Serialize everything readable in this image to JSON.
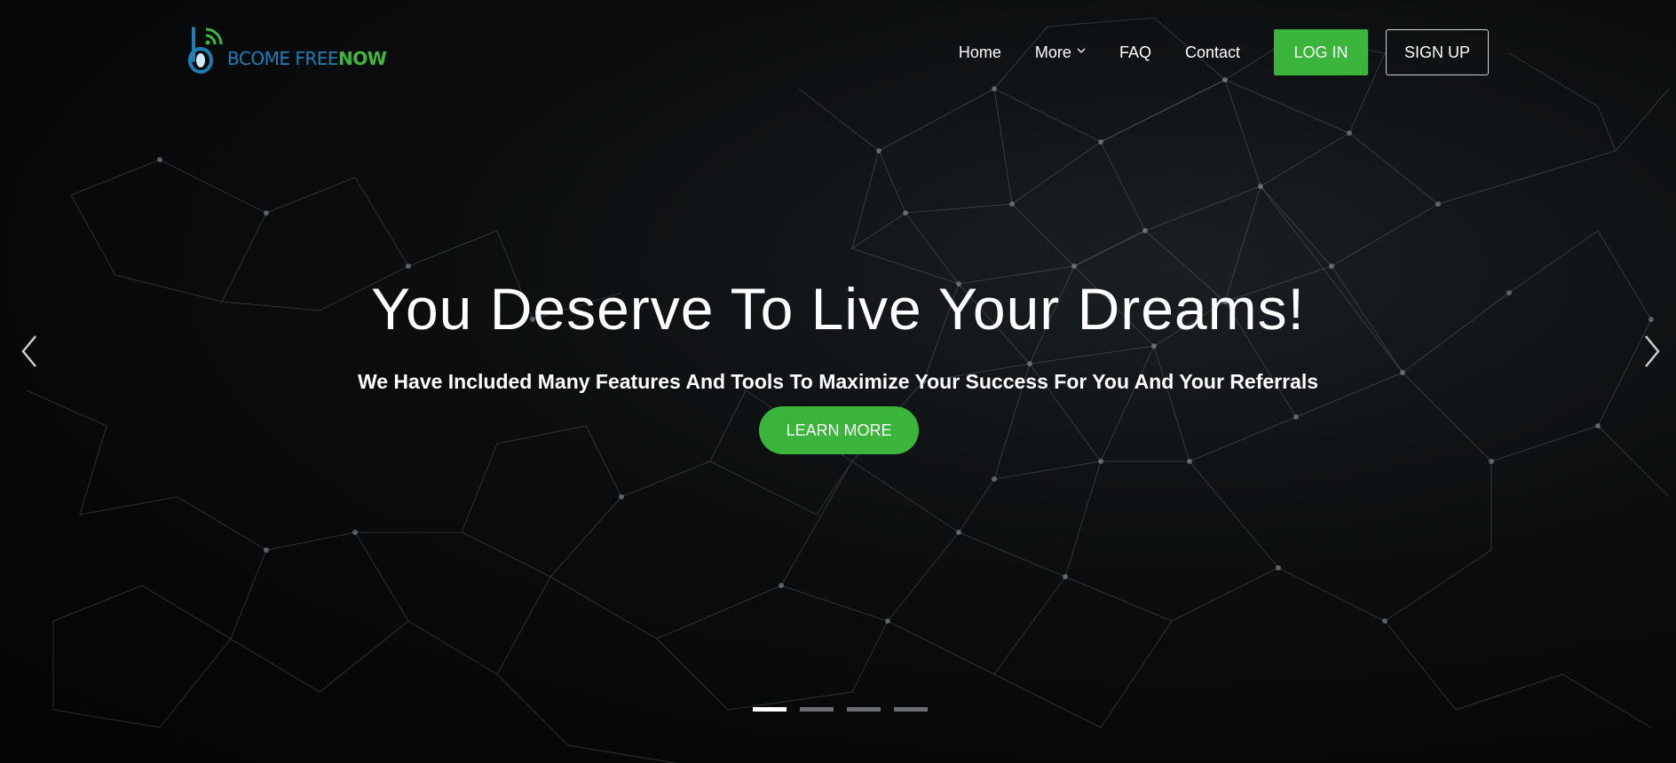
{
  "brand": {
    "name_part1": "BCOME FREE",
    "name_part2": "NOW",
    "logo_icon": "wifi-b-logo-icon",
    "color_blue": "#1d7fb8",
    "color_green": "#3cb93c"
  },
  "nav": {
    "items": [
      {
        "label": "Home"
      },
      {
        "label": "More",
        "icon": "chevron-down-icon"
      },
      {
        "label": "FAQ"
      },
      {
        "label": "Contact"
      }
    ],
    "login_label": "LOG IN",
    "signup_label": "SIGN UP"
  },
  "hero": {
    "headline": "You Deserve To Live Your Dreams!",
    "subheadline": "We Have Included Many Features And Tools To Maximize Your Success For You And Your Referrals",
    "cta_label": "LEARN MORE",
    "accent_color": "#3bb43b"
  },
  "carousel": {
    "prev_icon": "chevron-left-icon",
    "next_icon": "chevron-right-icon",
    "slide_count": 4,
    "active_slide": 1
  }
}
